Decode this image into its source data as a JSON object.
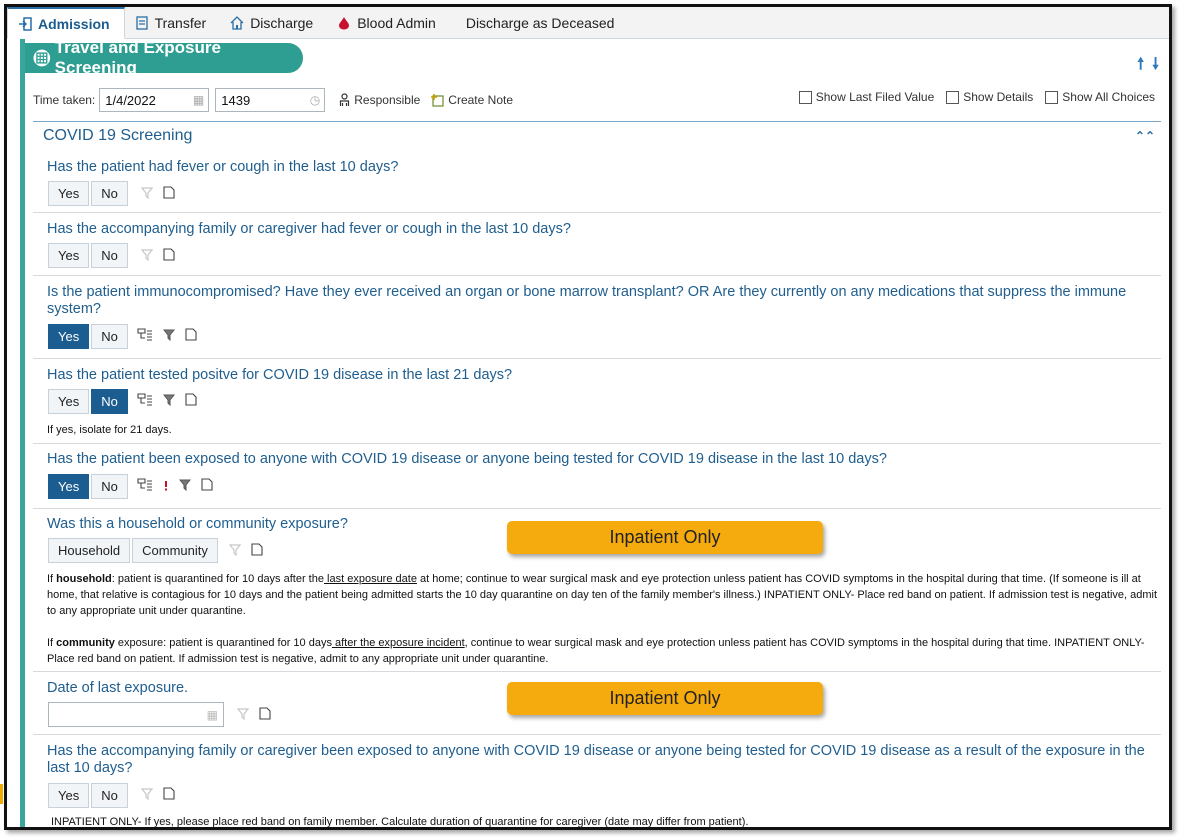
{
  "tabs": [
    {
      "label": "Admission",
      "icon": "admission-icon",
      "active": true
    },
    {
      "label": "Transfer",
      "icon": "transfer-icon",
      "active": false
    },
    {
      "label": "Discharge",
      "icon": "discharge-icon",
      "active": false
    },
    {
      "label": "Blood Admin",
      "icon": "blood-drop-icon",
      "active": false
    },
    {
      "label": "Discharge as Deceased",
      "icon": "",
      "active": false
    }
  ],
  "section": {
    "title": "Travel and Exposure Screening"
  },
  "time": {
    "label": "Time taken:",
    "date": "1/4/2022",
    "time": "1439",
    "responsible": "Responsible",
    "create_note": "Create Note"
  },
  "options": {
    "last_filed": "Show Last Filed Value",
    "details": "Show Details",
    "all_choices": "Show All Choices"
  },
  "group": {
    "title": "COVID 19 Screening"
  },
  "questions": [
    {
      "text": "Has the patient had fever or cough in the last 10 days?",
      "yes": "Yes",
      "no": "No",
      "selected": null
    },
    {
      "text": "Has the accompanying family or caregiver had fever or cough in the last 10 days?",
      "yes": "Yes",
      "no": "No",
      "selected": null
    },
    {
      "text": "Is the patient immunocompromised? Have they ever received an organ or bone marrow transplant? OR Are they currently on any medications that suppress the immune system?",
      "yes": "Yes",
      "no": "No",
      "selected": "Yes"
    },
    {
      "text": "Has the patient tested positve for COVID 19 disease in the last 21 days?",
      "yes": "Yes",
      "no": "No",
      "selected": "No",
      "note": "If yes, isolate for 21 days."
    },
    {
      "text": "Has the patient been exposed to anyone with COVID 19 disease or anyone being tested for COVID 19 disease in the last 10 days?",
      "yes": "Yes",
      "no": "No",
      "selected": "Yes"
    },
    {
      "text": "Was this a household or community exposure?",
      "opt1": "Household",
      "opt2": "Community",
      "banner": "Inpatient Only",
      "note1": {
        "prefix": "If ",
        "bold": "household",
        "a": ": patient is quarantined for 10 days after the",
        "u": " last exposure date",
        "b": " at home; continue to wear surgical mask and eye protection unless patient has COVID symptoms in the hospital during that time. (If someone is ill at home, that relative is contagious for 10 days and the patient being admitted starts the 10 day quarantine on day ten of the family member's illness.) INPATIENT ONLY- Place red band on patient. If admission test is negative, admit to any appropriate unit under quarantine."
      },
      "note2": {
        "prefix": "If ",
        "bold": "community",
        "a": " exposure: patient is quarantined for 10 days",
        "u": " after the exposure incident",
        "b": ", continue to wear surgical mask and eye protection unless patient has COVID symptoms in the hospital during that time. INPATIENT ONLY-Place red band on patient. If admission test is negative, admit to any appropriate unit under quarantine."
      }
    },
    {
      "text": "Date of last exposure.",
      "banner": "Inpatient Only"
    },
    {
      "text": "Has the accompanying family or caregiver been exposed to anyone with COVID 19 disease or anyone being tested for COVID 19 disease as a result of the exposure in the last 10 days?",
      "yes": "Yes",
      "no": "No",
      "selected": null,
      "note": "INPATIENT ONLY- If yes, please place red band on family member. Calculate duration of quarantine for caregiver (date may differ from patient)."
    }
  ]
}
